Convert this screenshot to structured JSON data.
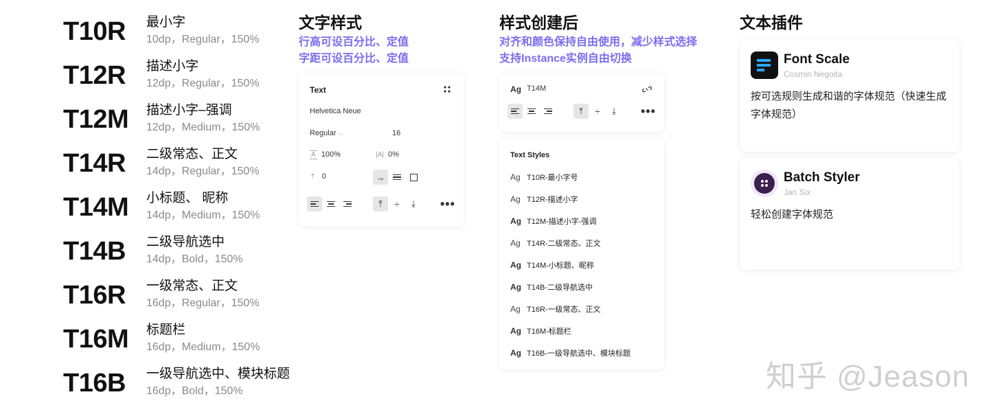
{
  "scale": [
    {
      "code": "T10R",
      "name": "最小字",
      "spec": "10dp，Regular，150%"
    },
    {
      "code": "T12R",
      "name": "描述小字",
      "spec": "12dp，Regular，150%"
    },
    {
      "code": "T12M",
      "name": "描述小字–强调",
      "spec": "12dp，Medium，150%"
    },
    {
      "code": "T14R",
      "name": "二级常态、正文",
      "spec": "14dp，Regular，150%"
    },
    {
      "code": "T14M",
      "name": "小标题、 昵称",
      "spec": "14dp，Medium，150%"
    },
    {
      "code": "T14B",
      "name": "二级导航选中",
      "spec": "14dp，Bold，150%"
    },
    {
      "code": "T16R",
      "name": "一级常态、正文",
      "spec": "16dp，Regular，150%"
    },
    {
      "code": "T16M",
      "name": "标题栏",
      "spec": "16dp，Medium，150%"
    },
    {
      "code": "T16B",
      "name": "一级导航选中、模块标题",
      "spec": "16dp，Bold，150%"
    }
  ],
  "text_style": {
    "title": "文字样式",
    "sub1": "行高可设百分比、定值",
    "sub2": "字距可设百分比、定值",
    "panel": {
      "label": "Text",
      "font": "Helvetica Neue",
      "weight": "Regular",
      "size": "16",
      "line_height": "100%",
      "letter_spacing": "0%",
      "paragraph_spacing": "0"
    }
  },
  "after_style": {
    "title": "样式创建后",
    "sub1": "对齐和颜色保持自由使用，减少样式选择",
    "sub2": "支持Instance实例自由切换",
    "panel": {
      "ag": "Ag",
      "style": "T14M"
    },
    "styles_label": "Text Styles",
    "styles": [
      {
        "ag": "Ag",
        "label": "T10R-最小字号",
        "weight": "regular"
      },
      {
        "ag": "Ag",
        "label": "T12R-描述小字",
        "weight": "regular"
      },
      {
        "ag": "Ag",
        "label": "T12M-描述小字-强调",
        "weight": "medium"
      },
      {
        "ag": "Ag",
        "label": "T14R-二级常态、正文",
        "weight": "regular"
      },
      {
        "ag": "Ag",
        "label": "T14M-小标题、昵称",
        "weight": "medium"
      },
      {
        "ag": "Ag",
        "label": "T14B-二级导航选中",
        "weight": "bold"
      },
      {
        "ag": "Ag",
        "label": "T16R-一级常态、正文",
        "weight": "regular"
      },
      {
        "ag": "Ag",
        "label": "T16M-标题栏",
        "weight": "medium"
      },
      {
        "ag": "Ag",
        "label": "T16B-一级导航选中、模块标题",
        "weight": "bold"
      }
    ]
  },
  "plugins": {
    "title": "文本插件",
    "items": [
      {
        "name": "Font Scale",
        "author": "Cosmin Negoita",
        "desc": "按可选规则生成和谐的字体规范（快速生成字体规范）",
        "icon": "font-scale-logo",
        "color": "#111111",
        "accent": "#2aa8ff"
      },
      {
        "name": "Batch Styler",
        "author": "Jan Six",
        "desc": "轻松创建字体规范",
        "icon": "batch-styler-logo",
        "color": "#3b1f4f"
      }
    ]
  },
  "watermark": "知乎 @Jeason"
}
